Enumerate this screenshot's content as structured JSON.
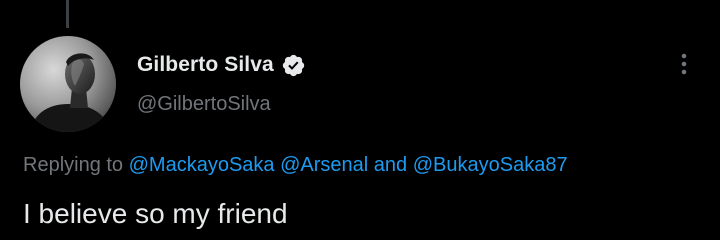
{
  "tweet": {
    "author": {
      "display_name": "Gilberto Silva",
      "handle": "@GilbertoSilva",
      "verified": true,
      "avatar_icon": "avatar-photo"
    },
    "menu_icon": "more-options-icon",
    "reply": {
      "prefix": "Replying to",
      "mention_1": "@MackayoSaka",
      "mention_2": "@Arsenal",
      "connector": "and",
      "mention_3": "@BukayoSaka87"
    },
    "text": "I believe so my friend"
  },
  "colors": {
    "background": "#000000",
    "primary_text": "#e7e9ea",
    "secondary_text": "#71767b",
    "link": "#1d9bf0",
    "verified_badge": "#e7e9ea"
  }
}
